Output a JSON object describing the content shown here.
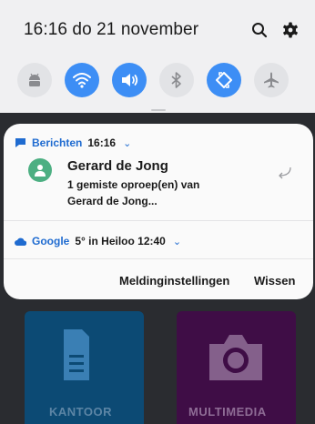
{
  "status_bar": {
    "time_date": "16:16  do 21 november",
    "icons": [
      "search-icon",
      "gear-icon"
    ]
  },
  "quick_settings": {
    "toggles": [
      {
        "name": "android-toggle",
        "state": "off"
      },
      {
        "name": "wifi-toggle",
        "state": "on"
      },
      {
        "name": "sound-toggle",
        "state": "on"
      },
      {
        "name": "bluetooth-toggle",
        "state": "off"
      },
      {
        "name": "auto-rotate-toggle",
        "state": "on"
      },
      {
        "name": "airplane-mode-toggle",
        "state": "off"
      }
    ]
  },
  "notification": {
    "app_name": "Berichten",
    "time": "16:16",
    "sender": "Gerard de Jong",
    "line1": "1 gemiste oproep(en) van",
    "line2": "Gerard de Jong..."
  },
  "weather": {
    "app_name": "Google",
    "text": "5° in Heiloo  12:40"
  },
  "actions": {
    "settings_label": "Meldinginstellingen",
    "clear_label": "Wissen"
  },
  "background_apps": {
    "left_label": "KANTOOR",
    "right_label": "MULTIMEDIA"
  },
  "colors": {
    "accent": "#3d8ef5",
    "link": "#1f6bd0",
    "avatar": "#4caf82"
  }
}
